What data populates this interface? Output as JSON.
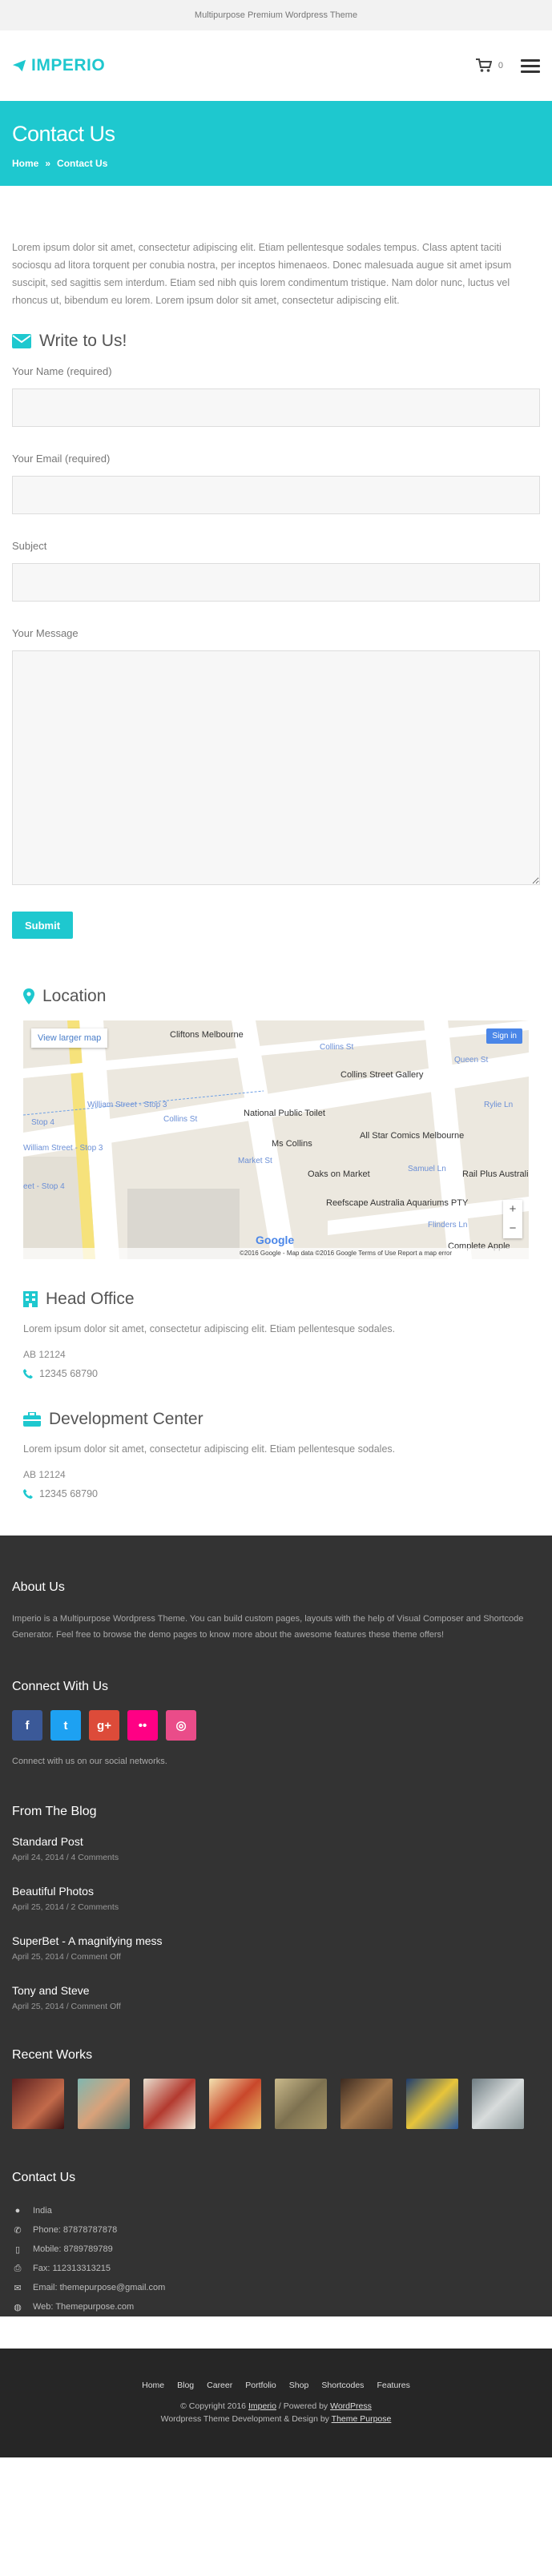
{
  "topbar": {
    "text": "Multipurpose Premium Wordpress Theme"
  },
  "header": {
    "logo_text": "IMPERIO",
    "cart_count": "0"
  },
  "page": {
    "title": "Contact Us",
    "breadcrumb_home": "Home",
    "breadcrumb_separator": "»",
    "breadcrumb_current": "Contact Us"
  },
  "intro": "Lorem ipsum dolor sit amet, consectetur adipiscing elit. Etiam pellentesque sodales tempus. Class aptent taciti sociosqu ad litora torquent per conubia nostra, per inceptos himenaeos. Donec malesuada augue sit amet ipsum suscipit, sed sagittis sem interdum. Etiam sed nibh quis lorem condimentum tristique. Nam dolor nunc, luctus vel rhoncus ut, bibendum eu lorem. Lorem ipsum dolor sit amet, consectetur adipiscing elit.",
  "form": {
    "title": "Write to Us!",
    "name_label": "Your Name (required)",
    "email_label": "Your Email (required)",
    "subject_label": "Subject",
    "message_label": "Your Message",
    "submit_label": "Submit"
  },
  "location": {
    "title": "Location",
    "larger_map": "View larger map",
    "sign_in": "Sign in",
    "google": "Google",
    "map_footer": "©2016 Google - Map data ©2016 Google    Terms of Use    Report a map error",
    "labels": {
      "cliftons": "Cliftons Melbourne",
      "gallery": "Collins Street Gallery",
      "toilet": "National Public Toilet",
      "comics": "All Star Comics Melbourne",
      "collins": "Ms Collins",
      "oaks": "Oaks on Market",
      "reefscape": "Reefscape Australia Aquariums PTY",
      "rail": "Rail Plus Australi",
      "complete": "Complete Apple"
    },
    "streets": {
      "collins_st_top": "Collins St",
      "collins_st_left": "Collins St",
      "william_3": "William Street - Stop 3",
      "william_3b": "William Street - Stop 3",
      "stop_4a": "Stop 4",
      "stop_4b": "eet - Stop 4",
      "market": "Market St",
      "queen": "Queen St",
      "rylie": "Rylie Ln",
      "flinders": "Flinders Ln",
      "samuel": "Samuel Ln"
    }
  },
  "head_office": {
    "title": "Head Office",
    "text": "Lorem ipsum dolor sit amet, consectetur adipiscing elit. Etiam pellentesque sodales.",
    "code": "AB 12124",
    "phone": "12345 68790"
  },
  "dev_center": {
    "title": "Development Center",
    "text": "Lorem ipsum dolor sit amet, consectetur adipiscing elit. Etiam pellentesque sodales.",
    "code": "AB 12124",
    "phone": "12345 68790"
  },
  "footer": {
    "about_title": "About Us",
    "about_text": "Imperio is a Multipurpose Wordpress Theme. You can build custom pages, layouts with the help of Visual Composer and Shortcode Generator. Feel free to browse the demo pages to know more about the awesome features these theme offers!",
    "connect_title": "Connect With Us",
    "connect_text": "Connect with us on our social networks.",
    "blog_title": "From The Blog",
    "posts": [
      {
        "title": "Standard Post",
        "meta": "April 24, 2014 / 4 Comments"
      },
      {
        "title": "Beautiful Photos",
        "meta": "April 25, 2014 / 2 Comments"
      },
      {
        "title": "SuperBet - A magnifying mess",
        "meta": "April 25, 2014 / Comment Off"
      },
      {
        "title": "Tony and Steve",
        "meta": "April 25, 2014 / Comment Off"
      }
    ],
    "works_title": "Recent Works",
    "contact_title": "Contact Us",
    "contact": {
      "country": "India",
      "phone": "Phone: 87878787878",
      "mobile": "Mobile: 8789789789",
      "fax": "Fax: 112313313215",
      "email": "Email: themepurpose@gmail.com",
      "web": "Web: Themepurpose.com"
    },
    "nav": [
      "Home",
      "Blog",
      "Career",
      "Portfolio",
      "Shop",
      "Shortcodes",
      "Features"
    ],
    "copyright_pre": "© Copyright 2016 ",
    "copyright_link": "Imperio",
    "copyright_mid": " / Powered by ",
    "copyright_wp": "WordPress",
    "credit_pre": "Wordpress Theme Development & Design by ",
    "credit_link": "Theme Purpose"
  },
  "colors": {
    "accent": "#1ec8cf",
    "footer_bg": "#333333",
    "bottombar_bg": "#262626"
  }
}
